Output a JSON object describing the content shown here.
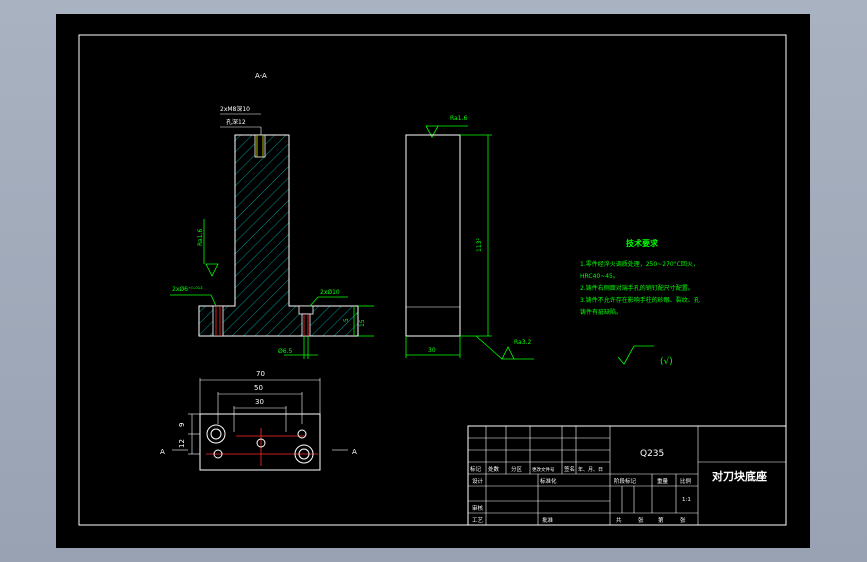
{
  "section_view": {
    "title": "A-A",
    "callout_thread": "2xM8深10",
    "callout_hole": "孔深12",
    "callout_side": "2xØ6⁺⁰·⁰¹²",
    "callout_counterbore": "2xØ10",
    "roughness": "Ra1.6",
    "dim_height": "15",
    "dim_diameter": "Ø6.5"
  },
  "front_view": {
    "roughness_top": "Ra1.6",
    "dim_height": "113²",
    "dim_width": "30",
    "roughness_side": "Ra3.2"
  },
  "tech_req": {
    "title": "技术要求",
    "lines": [
      "1.零件经淬火调质处理，250~270°C回火，",
      "HRC40~45。",
      "2.铸件右侧面对端手孔的销钉配尺寸配置。",
      "3.铸件不允许存在影响手柱的砂眼、裂纹、孔",
      "铸件有疵缺陷。"
    ],
    "symbol_note": "(√)"
  },
  "plan_view": {
    "dim_overall": "70",
    "dim_mid": "50",
    "dim_inner": "30",
    "dim_left_a": "9",
    "dim_left_b": "12",
    "section_mark": "A"
  },
  "title_block": {
    "material": "Q235",
    "part_name": "对刀块底座",
    "scale": "1:1",
    "hdr_labels": [
      "标记",
      "处数",
      "分区",
      "更改文件号",
      "签名",
      "年、月、日"
    ],
    "row_labels": [
      "设计",
      "审核",
      "工艺"
    ],
    "std_label": "标准化",
    "approve_label": "批准",
    "stage_labels": [
      "阶段标记",
      "重量",
      "比例"
    ],
    "sheet_labels": [
      "共",
      "张",
      "第",
      "张"
    ]
  }
}
